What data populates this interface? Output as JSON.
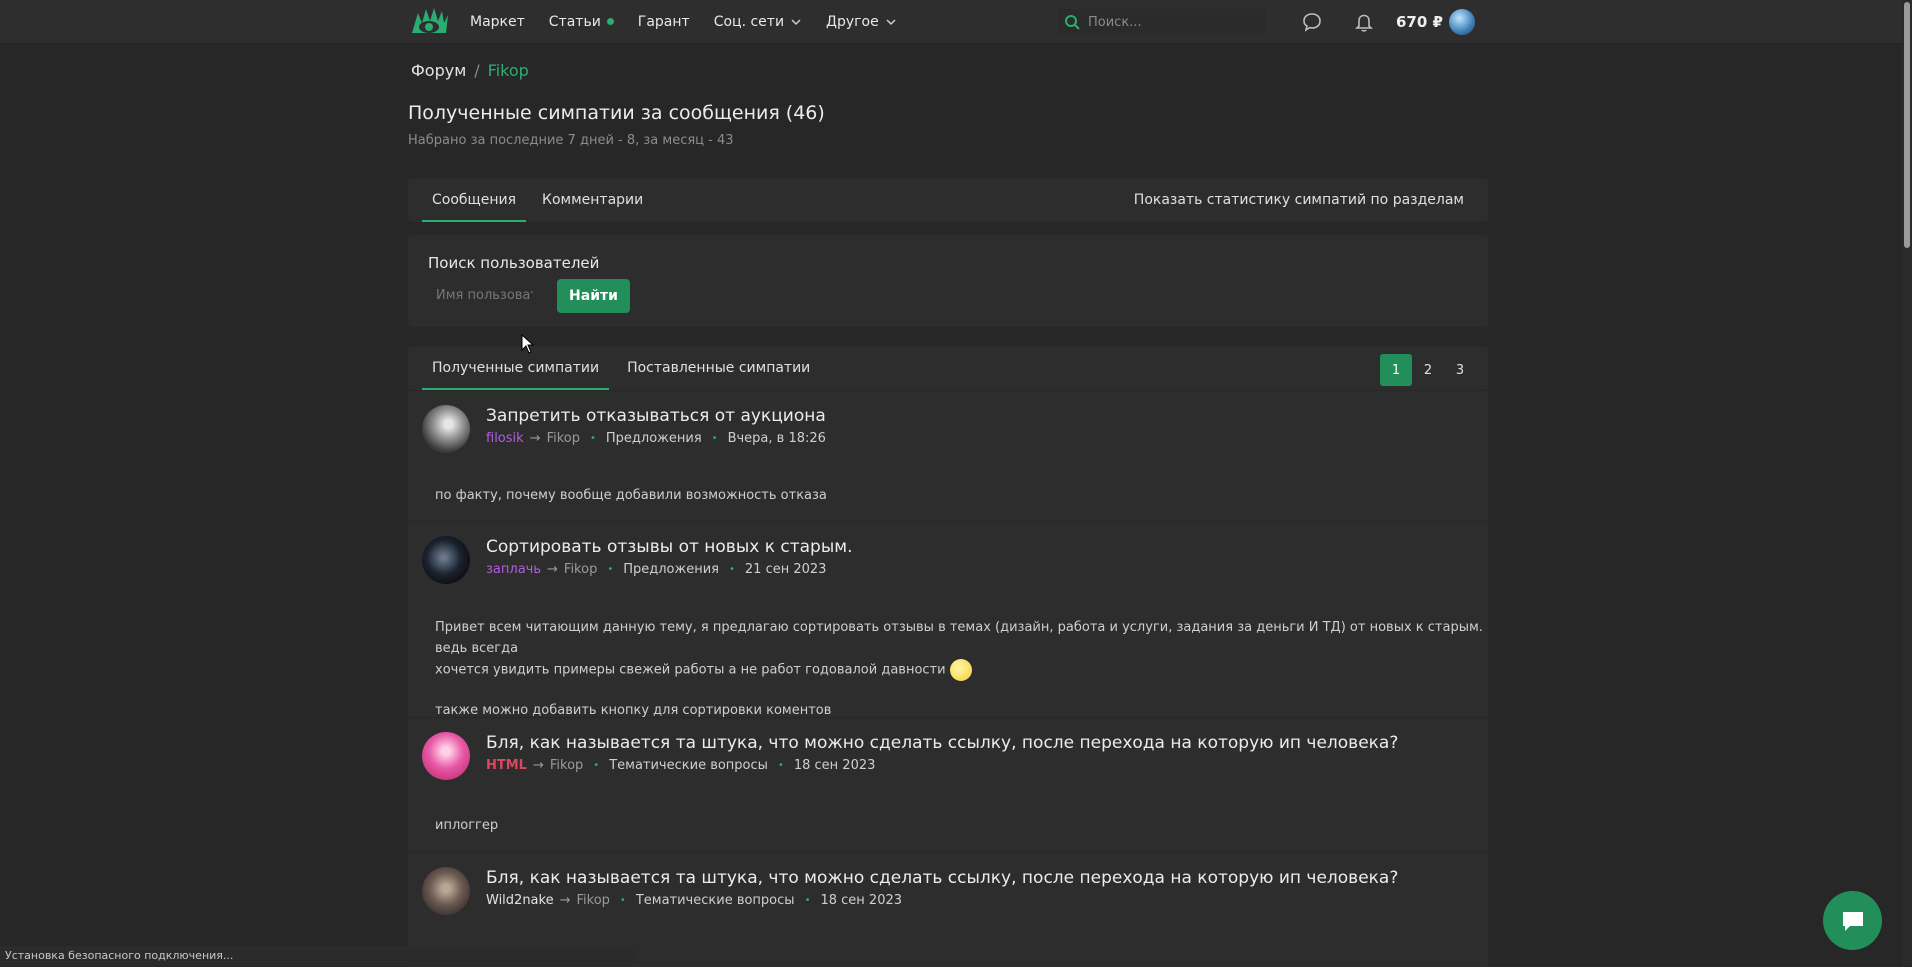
{
  "header": {
    "nav": [
      {
        "label": "Маркет"
      },
      {
        "label": "Статьи"
      },
      {
        "label": "Гарант"
      },
      {
        "label": "Соц. сети"
      },
      {
        "label": "Другое"
      }
    ],
    "search_placeholder": "Поиск...",
    "balance": "670 ₽",
    "accent_color": "#2bad72"
  },
  "breadcrumb": {
    "root": "Форум",
    "separator": "/",
    "current": "Fikop"
  },
  "page": {
    "title": "Полученные симпатии за сообщения (46)",
    "subtitle": "Набрано за последние 7 дней - 8, за месяц - 43"
  },
  "type_tabs": {
    "messages": "Сообщения",
    "comments": "Комментарии",
    "stats_link": "Показать статистику симпатий по разделам"
  },
  "user_search": {
    "label": "Поиск пользователей",
    "placeholder": "Имя пользователя",
    "button": "Найти"
  },
  "likes_tabs": {
    "received": "Полученные симпатии",
    "given": "Поставленные симпатии",
    "pages": [
      "1",
      "2",
      "3"
    ],
    "current_page": "1"
  },
  "posts": [
    {
      "title": "Запретить отказываться от аукциона",
      "author": "filosik",
      "author_color": "#b05de0",
      "arrow": "→",
      "target": "Fikop",
      "section": "Предложения",
      "date": "Вчера, в 18:26",
      "body": [
        "по факту, почему вообще добавили возможность отказа"
      ]
    },
    {
      "title": "Сортировать отзывы от новых к старым.",
      "author": "заплачь",
      "author_color": "#b05de0",
      "arrow": "→",
      "target": "Fikop",
      "section": "Предложения",
      "date": "21 сен 2023",
      "body": [
        "Привет всем читающим данную тему, я предлагаю сортировать отзывы в темах (дизайн, работа и услуги, задания за деньги И ТД) от новых к старым. ведь всегда",
        "хочется увидить примеры свежей работы а не работ годовалой давности",
        "также можно добавить кнопку для сортировки коментов"
      ]
    },
    {
      "title": "Бля, как называется та штука, что можно сделать ссылку, после перехода на которую ип человека?",
      "author": "HTML",
      "author_color": "#e0455f",
      "arrow": "→",
      "target": "Fikop",
      "section": "Тематические вопросы",
      "date": "18 сен 2023",
      "body": [
        "иплоггер"
      ]
    },
    {
      "title": "Бля, как называется та штука, что можно сделать ссылку, после перехода на которую ип человека?",
      "author": "Wild2nake",
      "author_color": "#e4e4e4",
      "arrow": "→",
      "target": "Fikop",
      "section": "Тематические вопросы",
      "date": "18 сен 2023",
      "body": []
    }
  ],
  "status_bar": "Установка безопасного подключения..."
}
